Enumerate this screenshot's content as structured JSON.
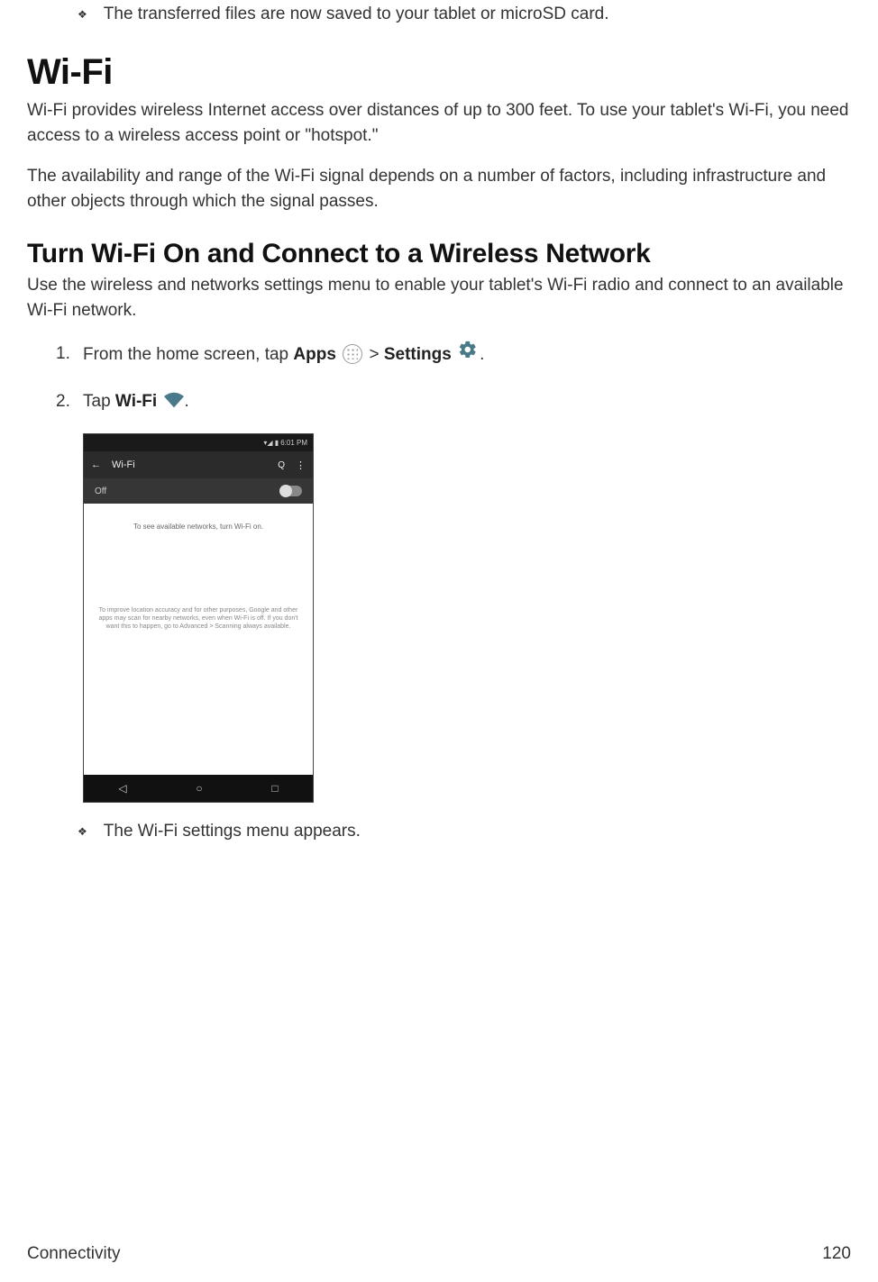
{
  "bullet_top": "The transferred files are now saved to your tablet or microSD card.",
  "h1": "Wi-Fi",
  "p1": "Wi-Fi provides wireless Internet access over distances of up to 300 feet. To use your tablet's Wi-Fi, you need access to a wireless access point or \"hotspot.\"",
  "p2": "The availability and range of the Wi-Fi signal depends on a number of factors, including infrastructure and other objects through which the signal passes.",
  "h2": "Turn Wi-Fi On and Connect to a Wireless Network",
  "p3": "Use the wireless and networks settings menu to enable your tablet's Wi-Fi radio and connect to an available Wi-Fi network.",
  "step1": {
    "num": "1.",
    "a": "From the home screen, tap ",
    "apps": "Apps",
    "gt": " > ",
    "settings": "Settings",
    "end": "."
  },
  "step2": {
    "num": "2.",
    "a": "Tap ",
    "wifi": "Wi-Fi",
    "end": "."
  },
  "screenshot": {
    "time": "6:01 PM",
    "back": "←",
    "title": "Wi-Fi",
    "search": "🔍",
    "more": "⋮",
    "off": "Off",
    "msg1": "To see available networks, turn Wi-Fi on.",
    "msg2": "To improve location accuracy and for other purposes, Google and other apps may scan for nearby networks, even when Wi-Fi is off. If you don't want this to happen, go to Advanced > Scanning always available.",
    "nav_back": "◁",
    "nav_home": "○",
    "nav_recent": "□"
  },
  "result_bullet": "The Wi-Fi settings menu appears.",
  "footer_left": "Connectivity",
  "footer_right": "120",
  "diamond_char": "❖"
}
